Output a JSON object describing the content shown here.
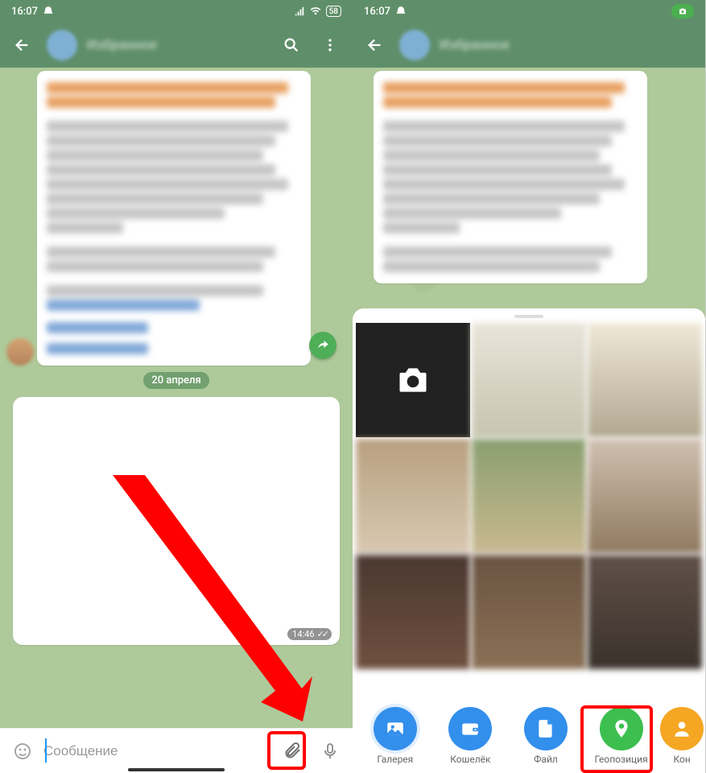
{
  "status": {
    "time": "16:07",
    "battery": "58"
  },
  "header": {
    "chat_name": "Избранное"
  },
  "chat": {
    "date_label": "20 апреля",
    "msg_time": "14:46"
  },
  "input": {
    "placeholder": "Сообщение"
  },
  "attach": {
    "gallery": "Галерея",
    "wallet": "Кошелёк",
    "file": "Файл",
    "geo": "Геопозиция",
    "contact": "Кон"
  }
}
